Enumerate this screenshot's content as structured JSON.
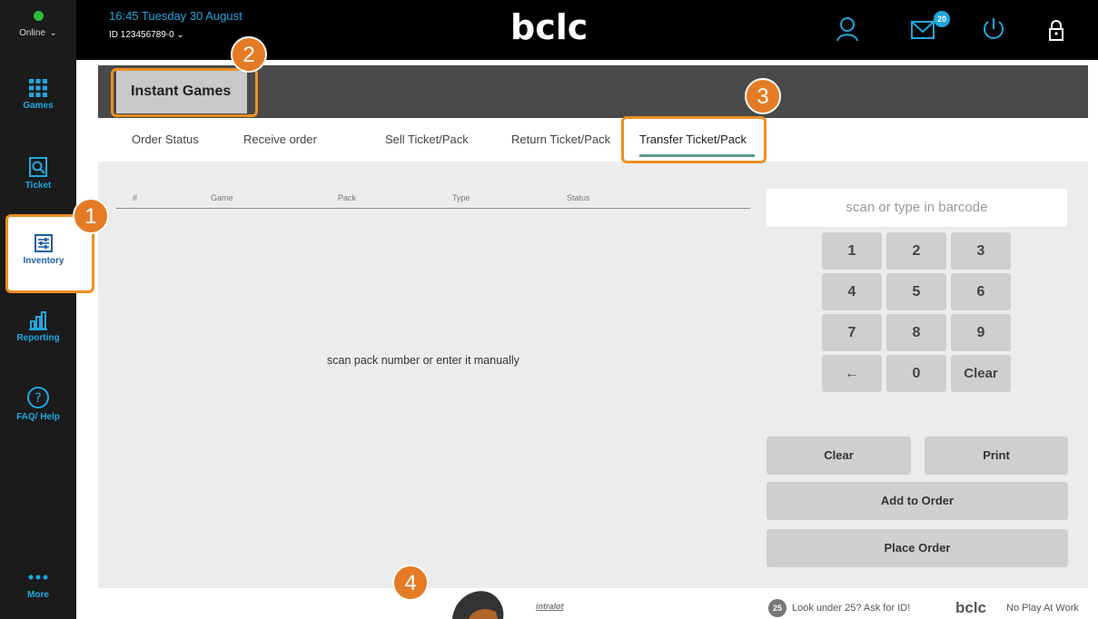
{
  "status": {
    "label": "Online",
    "color": "#2ebd3a"
  },
  "sidebar": {
    "items": [
      {
        "label": "Games",
        "icon": "grid-icon"
      },
      {
        "label": "Ticket",
        "icon": "ticket-icon"
      },
      {
        "label": "Inventory",
        "icon": "inventory-icon"
      },
      {
        "label": "Reporting",
        "icon": "bar-chart-icon"
      },
      {
        "label": "FAQ/ Help",
        "icon": "help-icon"
      },
      {
        "label": "More",
        "icon": "more-dots-icon"
      }
    ]
  },
  "header": {
    "datetime": "16:45 Tuesday 30 August",
    "user_id": "ID 123456789-0",
    "logo": "bclc",
    "notification_count": "20"
  },
  "main": {
    "section_tab": "Instant Games",
    "subtabs": [
      "Order Status",
      "Receive order",
      "Sell Ticket/Pack",
      "Return Ticket/Pack",
      "Transfer Ticket/Pack"
    ],
    "table": {
      "columns": [
        "#",
        "Game",
        "Pack",
        "Type",
        "Status"
      ],
      "empty_message": "scan pack number or enter it manually"
    },
    "barcode_placeholder": "scan or type in barcode",
    "keypad": [
      "1",
      "2",
      "3",
      "4",
      "5",
      "6",
      "7",
      "8",
      "9",
      "←",
      "0",
      "Clear"
    ],
    "buttons": {
      "clear": "Clear",
      "print": "Print",
      "add_to_order": "Add to Order",
      "place_order": "Place Order"
    }
  },
  "callouts": [
    "1",
    "2",
    "3",
    "4"
  ],
  "footer": {
    "intralot": "intralot",
    "age_badge": "25",
    "age_notice": "Look under 25? Ask for ID!",
    "brand": "bclc",
    "tagline": "No Play At Work"
  },
  "colors": {
    "accent": "#1fa8e0",
    "highlight": "#ee8f21",
    "callout": "#e57a25"
  }
}
